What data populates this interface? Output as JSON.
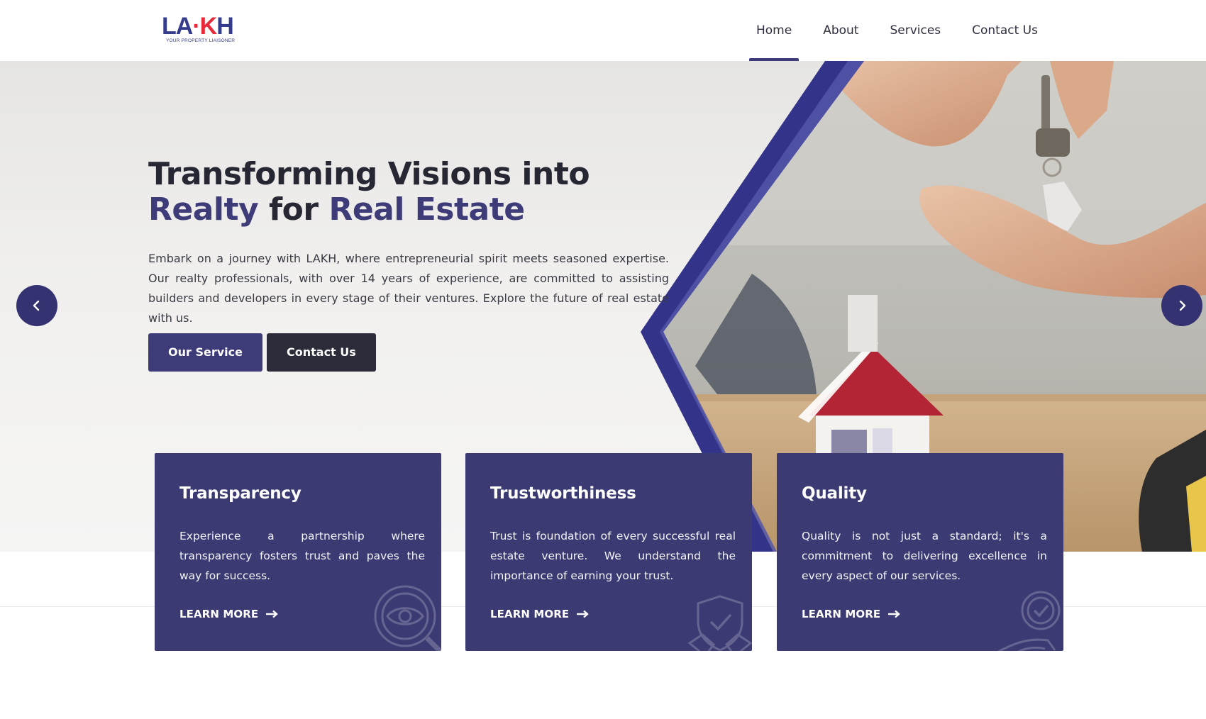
{
  "brand": {
    "logo_text_a": "LA",
    "logo_text_dot": "·",
    "logo_text_k": "K",
    "logo_text_h": "H",
    "tagline": "YOUR PROPERTY LIAISONER",
    "primary_color": "#3d3b78",
    "accent_red": "#e52a3a"
  },
  "nav": {
    "items": [
      {
        "label": "Home",
        "active": true
      },
      {
        "label": "About",
        "active": false
      },
      {
        "label": "Services",
        "active": false
      },
      {
        "label": "Contact Us",
        "active": false
      }
    ]
  },
  "hero": {
    "title_line1": "Transforming Visions into",
    "title_word1": "Realty",
    "title_word2": " for ",
    "title_word3": "Real Estate",
    "description": "Embark on a journey with LAKH, where entrepreneurial spirit meets seasoned expertise. Our realty professionals, with over 14 years of experience, are committed to assisting builders and developers in every stage of their ventures. Explore the future of real estate with us.",
    "primary_button": "Our Service",
    "secondary_button": "Contact Us",
    "prev_icon": "chevron-left-icon",
    "next_icon": "chevron-right-icon"
  },
  "cards": [
    {
      "title": "Transparency",
      "text": "Experience a partnership where transparency fosters trust and paves the way for success.",
      "link": "LEARN MORE",
      "icon": "eye-magnifier-icon"
    },
    {
      "title": "Trustworthiness",
      "text": "Trust is foundation of every successful real estate venture. We understand the importance of earning your trust.",
      "link": "LEARN MORE",
      "icon": "shield-handshake-icon"
    },
    {
      "title": "Quality",
      "text": "Quality is not just a standard; it's a commitment to delivering excellence in every aspect of our services.",
      "link": "LEARN MORE",
      "icon": "quality-badge-icon"
    }
  ]
}
